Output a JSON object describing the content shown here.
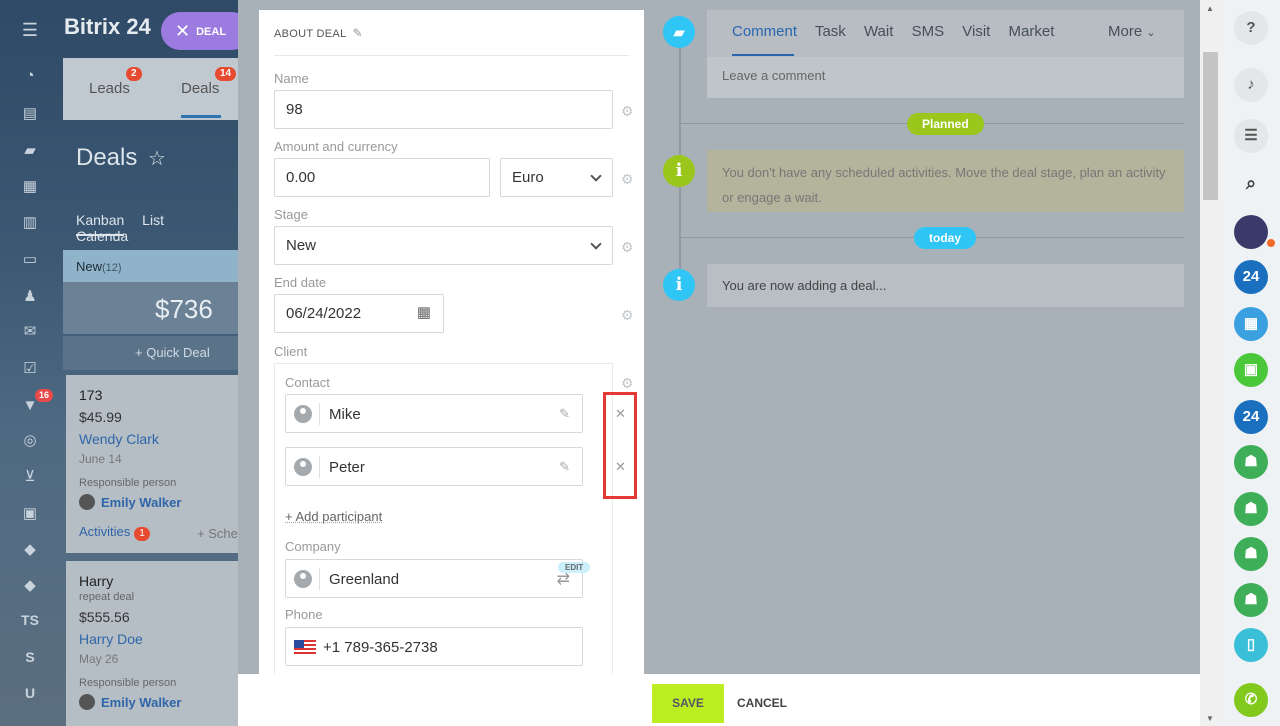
{
  "left_bg": {
    "logo": "Bitrix 24",
    "deal_chip": "DEAL",
    "tabs": [
      {
        "label": "Leads",
        "badge": "2"
      },
      {
        "label": "Deals",
        "badge": "14"
      }
    ],
    "page_title": "Deals",
    "views": [
      "Kanban",
      "List",
      "Calenda"
    ],
    "column": {
      "name": "New",
      "count": "(12)",
      "total": "$736",
      "quick_deal": "+ Quick Deal"
    },
    "rail_badge": "16",
    "rail_text": [
      "TS",
      "S",
      "U"
    ],
    "cards": [
      {
        "title": "173",
        "sum": "$45.99",
        "contact": "Wendy Clark",
        "date": "June 14",
        "resp_label": "Responsible person",
        "user": "Emily Walker",
        "activities": "Activities",
        "act_count": "1",
        "schedule": "+ Sche"
      },
      {
        "title": "Harry",
        "subtitle": "repeat deal",
        "sum": "$555.56",
        "contact": "Harry Doe",
        "date": "May 26",
        "resp_label": "Responsible person",
        "user": "Emily Walker"
      }
    ]
  },
  "form": {
    "section_title": "ABOUT DEAL",
    "name_label": "Name",
    "name_value": "98",
    "amount_label": "Amount and currency",
    "amount_value": "0.00",
    "currency_value": "Euro",
    "stage_label": "Stage",
    "stage_value": "New",
    "enddate_label": "End date",
    "enddate_value": "06/24/2022",
    "client_label": "Client",
    "contact_label": "Contact",
    "contacts": [
      "Mike",
      "Peter"
    ],
    "add_participant": "+ Add participant",
    "company_label": "Company",
    "company_value": "Greenland",
    "edit_pill": "EDIT",
    "phone_label": "Phone",
    "phone_value": "+1 789-365-2738"
  },
  "timeline": {
    "tabs": [
      "Comment",
      "Task",
      "Wait",
      "SMS",
      "Visit",
      "Market"
    ],
    "more": "More",
    "comment_placeholder": "Leave a comment",
    "planned_pill": "Planned",
    "planned_text": "You don't have any scheduled activities. Move the deal stage, plan an activity or engage a wait.",
    "today_pill": "today",
    "now_text": "You are now adding a deal..."
  },
  "buttons": {
    "save": "SAVE",
    "cancel": "CANCEL"
  },
  "right_rail": {
    "items": [
      "help-icon",
      "bell-icon",
      "chat-icon",
      "search-icon",
      "avatar",
      "b24-icon",
      "calendar-icon",
      "lock-icon",
      "b24-icon",
      "group-icon",
      "group-icon",
      "group-icon",
      "group-icon",
      "phone-device-icon",
      "call-icon"
    ],
    "b24_text": "24"
  },
  "colors": {
    "accent_green": "#bbed21",
    "highlight_red": "#e53935",
    "planned_green": "#9bc71c",
    "today_blue": "#2fc6f6",
    "link_blue": "#2a66b0"
  }
}
